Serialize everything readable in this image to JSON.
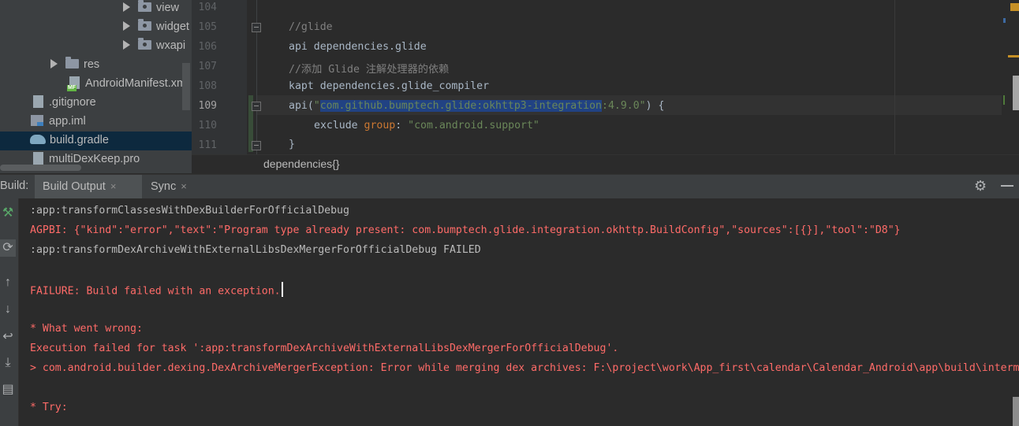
{
  "project_tree": {
    "items": [
      {
        "label": "view",
        "kind": "folder"
      },
      {
        "label": "widget",
        "kind": "folder"
      },
      {
        "label": "wxapi",
        "kind": "folder"
      },
      {
        "label": "res",
        "kind": "res-folder"
      },
      {
        "label": "AndroidManifest.xml",
        "kind": "manifest",
        "badge": "MF"
      },
      {
        "label": ".gitignore",
        "kind": "file"
      },
      {
        "label": "app.iml",
        "kind": "iml"
      },
      {
        "label": "build.gradle",
        "kind": "gradle",
        "selected": true
      },
      {
        "label": "multiDexKeep.pro",
        "kind": "file"
      }
    ]
  },
  "editor": {
    "line_numbers": [
      "104",
      "105",
      "106",
      "107",
      "108",
      "109",
      "110",
      "111"
    ],
    "current_line": "109",
    "lines": {
      "l105": "//glide",
      "l106": "api dependencies.glide",
      "l107": "//添加 Glide 注解处理器的依赖",
      "l108": "kapt dependencies.glide_compiler",
      "l109_pre": "api(",
      "l109_q1": "\"",
      "l109_sel": "com.github.bumptech.glide:okhttp3-integration",
      "l109_str": ":4.9.0\"",
      "l109_post": ") {",
      "l110_kw": "exclude ",
      "l110_group": "group",
      "l110_colon": ": ",
      "l110_str": "\"com.android.support\"",
      "l111": "}"
    },
    "breadcrumb": "dependencies{}"
  },
  "build_window": {
    "label": "Build:",
    "tabs": [
      {
        "label": "Build Output",
        "active": true
      },
      {
        "label": "Sync",
        "active": false
      }
    ],
    "close_glyph": "×",
    "toolbar_icons": [
      "hammer-icon",
      "rerun-icon",
      "up-arrow-icon",
      "down-arrow-icon",
      "soft-wrap-icon",
      "scroll-to-end-icon",
      "print-icon"
    ],
    "console": {
      "l1": ":app:transformClassesWithDexBuilderForOfficialDebug",
      "l2": "AGPBI: {\"kind\":\"error\",\"text\":\"Program type already present: com.bumptech.glide.integration.okhttp.BuildConfig\",\"sources\":[{}],\"tool\":\"D8\"}",
      "l3": ":app:transformDexArchiveWithExternalLibsDexMergerForOfficialDebug FAILED",
      "l4": "FAILURE: Build failed with an exception.",
      "l5": "* What went wrong:",
      "l6": "Execution failed for task ':app:transformDexArchiveWithExternalLibsDexMergerForOfficialDebug'.",
      "l7": "> com.android.builder.dexing.DexArchiveMergerException: Error while merging dex archives: F:\\project\\work\\App_first\\calendar\\Calendar_Android\\app\\build\\intermediates",
      "l8": "* Try:"
    }
  },
  "colors": {
    "error_text": "#ff6b68",
    "selection": "#214283",
    "string": "#6a8759",
    "comment": "#808080",
    "tree_selected": "#0d293e"
  }
}
